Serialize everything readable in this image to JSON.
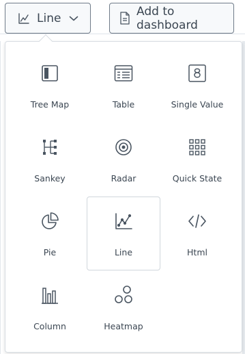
{
  "toolbar": {
    "chart_type_button": {
      "label": "Line",
      "icon": "line-chart-icon",
      "dropdown_icon": "chevron-down-icon"
    },
    "add_to_dashboard_button": {
      "label": "Add to dashboard",
      "icon": "document-icon"
    }
  },
  "chart_menu": {
    "selected": "Line",
    "items": [
      {
        "label": "Tree Map",
        "icon": "tree-map-icon"
      },
      {
        "label": "Table",
        "icon": "table-icon"
      },
      {
        "label": "Single Value",
        "icon": "single-value-icon",
        "glyph": "8"
      },
      {
        "label": "Sankey",
        "icon": "sankey-icon"
      },
      {
        "label": "Radar",
        "icon": "radar-icon"
      },
      {
        "label": "Quick State",
        "icon": "quick-state-icon"
      },
      {
        "label": "Pie",
        "icon": "pie-chart-icon"
      },
      {
        "label": "Line",
        "icon": "line-chart-icon"
      },
      {
        "label": "Html",
        "icon": "code-icon"
      },
      {
        "label": "Column",
        "icon": "column-chart-icon"
      },
      {
        "label": "Heatmap",
        "icon": "heatmap-icon"
      }
    ]
  },
  "colors": {
    "text": "#3b4652",
    "icon": "#4a5561",
    "border": "#6f7b88",
    "button_bg": "#f7f9fb"
  }
}
